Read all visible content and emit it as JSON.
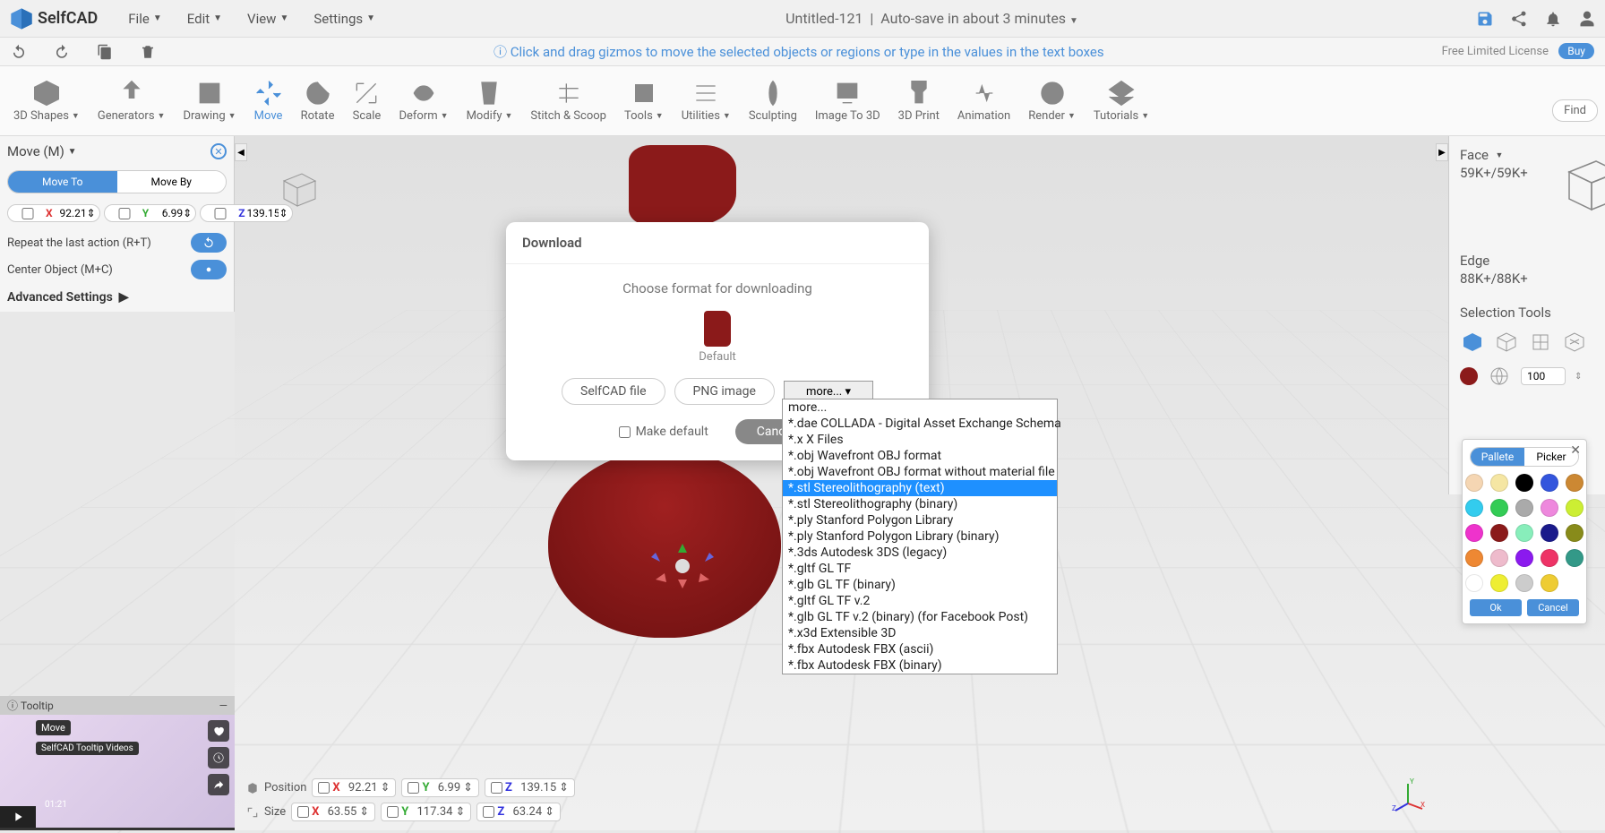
{
  "app": {
    "name": "SelfCAD",
    "menus": [
      "File",
      "Edit",
      "View",
      "Settings"
    ],
    "title_center": "Untitled-121",
    "autosave": "Auto-save in about 3 minutes"
  },
  "hint": "Click and drag gizmos to move the selected objects or regions or type in the values in the text boxes",
  "license": "Free Limited License",
  "buy": "Buy",
  "toolbar": [
    {
      "label": "3D Shapes",
      "caret": true
    },
    {
      "label": "Generators",
      "caret": true
    },
    {
      "label": "Drawing",
      "caret": true
    },
    {
      "label": "Move",
      "caret": false,
      "active": true
    },
    {
      "label": "Rotate",
      "caret": false
    },
    {
      "label": "Scale",
      "caret": false
    },
    {
      "label": "Deform",
      "caret": true
    },
    {
      "label": "Modify",
      "caret": true
    },
    {
      "label": "Stitch & Scoop",
      "caret": false
    },
    {
      "label": "Tools",
      "caret": true
    },
    {
      "label": "Utilities",
      "caret": true
    },
    {
      "label": "Sculpting",
      "caret": false
    },
    {
      "label": "Image To 3D",
      "caret": false
    },
    {
      "label": "3D Print",
      "caret": false
    },
    {
      "label": "Animation",
      "caret": false
    },
    {
      "label": "Render",
      "caret": true
    },
    {
      "label": "Tutorials",
      "caret": true
    }
  ],
  "left_panel": {
    "title": "Move (M)",
    "seg1": "Move To",
    "seg2": "Move By",
    "x": "92.21",
    "y": "6.99",
    "z": "139.15",
    "action1": "Repeat the last action (R+T)",
    "action2": "Center Object (M+C)",
    "adv": "Advanced Settings"
  },
  "right_panel": {
    "face": "Face",
    "face_val": "59K+/59K+",
    "edge": "Edge",
    "edge_val": "88K+/88K+",
    "sel_tools": "Selection Tools",
    "num": "100"
  },
  "dialog": {
    "title": "Download",
    "msg": "Choose format for downloading",
    "thumb_label": "Default",
    "btn1": "SelfCAD file",
    "btn2": "PNG image",
    "select": "more...",
    "make_default": "Make default",
    "cancel": "Cancel"
  },
  "dropdown_options": [
    "more...",
    "*.dae COLLADA - Digital Asset Exchange Schema",
    "*.x X Files",
    "*.obj Wavefront OBJ format",
    "*.obj Wavefront OBJ format without material file",
    "*.stl Stereolithography (text)",
    "*.stl Stereolithography (binary)",
    "*.ply Stanford Polygon Library",
    "*.ply Stanford Polygon Library (binary)",
    "*.3ds Autodesk 3DS (legacy)",
    "*.gltf GL TF",
    "*.glb GL TF (binary)",
    "*.gltf GL TF v.2",
    "*.glb GL TF v.2 (binary) (for Facebook Post)",
    "*.x3d Extensible 3D",
    "*.fbx Autodesk FBX (ascii)",
    "*.fbx Autodesk FBX (binary)"
  ],
  "dropdown_highlighted_index": 5,
  "status": {
    "position": "Position",
    "size": "Size",
    "px": "92.21",
    "py": "6.99",
    "pz": "139.15",
    "sx": "63.55",
    "sy": "117.34",
    "sz": "63.24"
  },
  "tooltip": {
    "header": "Tooltip",
    "badge": "Move",
    "subtitle": "SelfCAD Tooltip Videos",
    "time": "01:21"
  },
  "picker": {
    "tab1": "Pallete",
    "tab2": "Picker",
    "ok": "Ok",
    "cancel": "Cancel",
    "colors": [
      "#f5d6b3",
      "#f5e6a3",
      "#000000",
      "#3355dd",
      "#cc8833",
      "#33ccee",
      "#33cc55",
      "#aaaaaa",
      "#ee88dd",
      "#ccee33",
      "#ee33cc",
      "#8b1a1a",
      "#88eebb",
      "#1a1a8b",
      "#888b1a",
      "#ee8833",
      "#eebbcc",
      "#8b1aee",
      "#ee3366",
      "#339988",
      "#ffffff",
      "#eeee33",
      "#cccccc",
      "#eecc33"
    ]
  },
  "find": "Find"
}
